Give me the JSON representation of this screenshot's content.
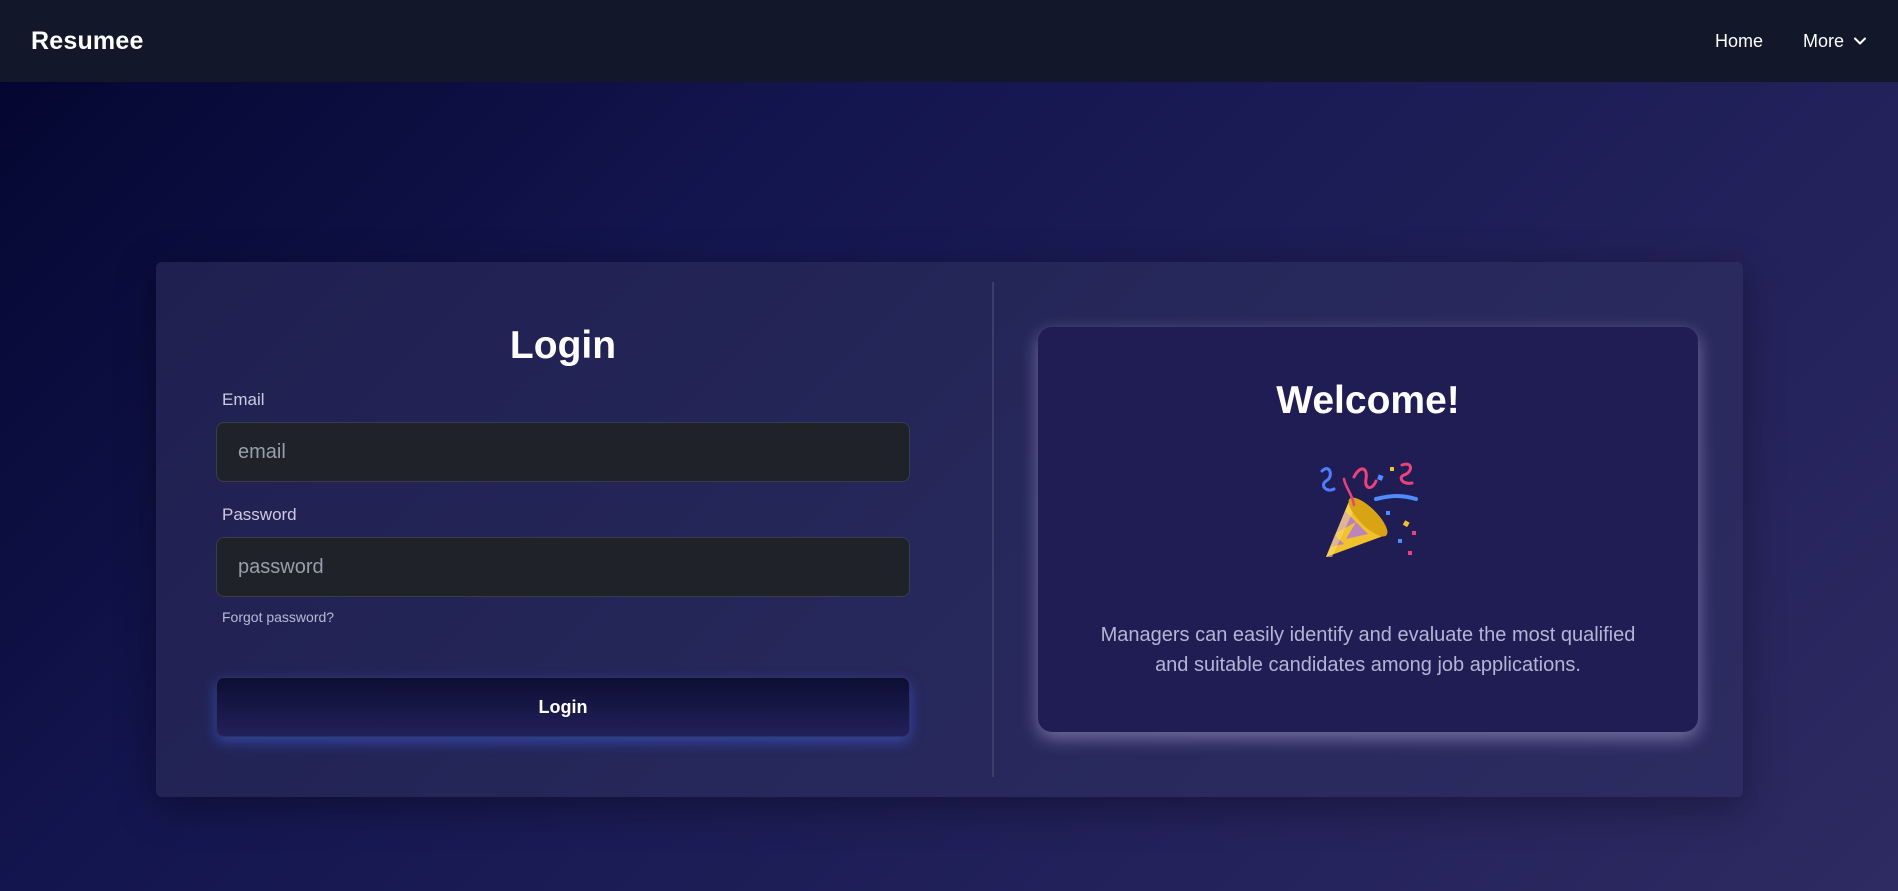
{
  "navbar": {
    "brand": "Resumee",
    "links": [
      {
        "label": "Home"
      },
      {
        "label": "More"
      }
    ]
  },
  "login": {
    "title": "Login",
    "email": {
      "label": "Email",
      "placeholder": "email",
      "value": ""
    },
    "password": {
      "label": "Password",
      "placeholder": "password",
      "value": ""
    },
    "forgot_label": "Forgot password?",
    "button_label": "Login"
  },
  "welcome": {
    "title": "Welcome!",
    "icon": "party-popper-icon",
    "text": "Managers can easily identify and evaluate the most qualified and suitable candidates among job applications."
  },
  "colors": {
    "navbar_bg": "#121729",
    "panel_bg": "#201d55",
    "input_bg": "#1f2229",
    "button_glow": "#466eff"
  }
}
